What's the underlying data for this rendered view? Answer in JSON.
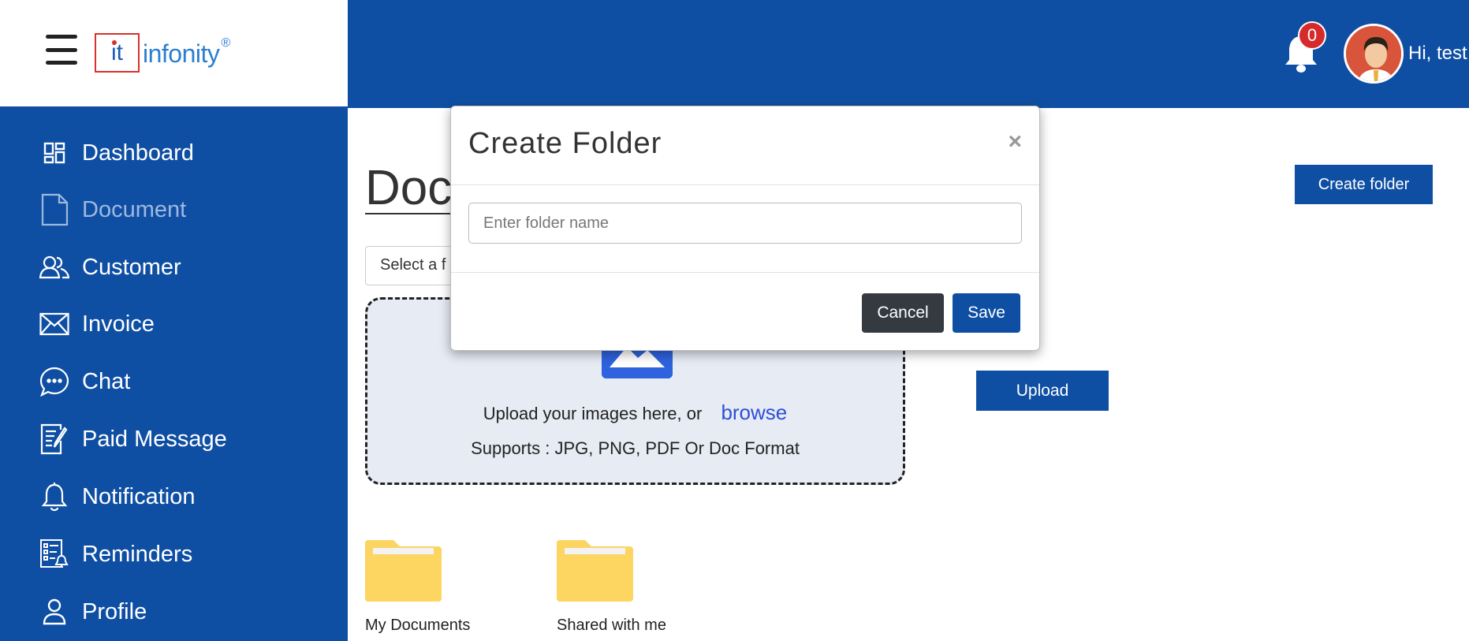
{
  "brand": {
    "logo_mark": "it",
    "logo_text": "infonity",
    "registered": "®"
  },
  "header": {
    "notification_count": "0",
    "greeting": "Hi, test"
  },
  "sidebar": {
    "items": [
      {
        "label": "Dashboard",
        "icon": "dashboard-icon"
      },
      {
        "label": "Document",
        "icon": "document-icon",
        "active": true
      },
      {
        "label": "Customer",
        "icon": "customer-icon"
      },
      {
        "label": "Invoice",
        "icon": "invoice-icon"
      },
      {
        "label": "Chat",
        "icon": "chat-icon"
      },
      {
        "label": "Paid Message",
        "icon": "paid-message-icon"
      },
      {
        "label": "Notification",
        "icon": "bell-icon"
      },
      {
        "label": "Reminders",
        "icon": "reminders-icon"
      },
      {
        "label": "Profile",
        "icon": "profile-icon"
      }
    ]
  },
  "main": {
    "title": "Doc",
    "folder_select": "Select a f",
    "create_folder_label": "Create folder",
    "upload_label": "Upload",
    "dropzone": {
      "text": "Upload your images here, or",
      "browse": "browse",
      "supports": "Supports : JPG, PNG, PDF Or Doc Format"
    },
    "folders": [
      {
        "label": "My Documents"
      },
      {
        "label": "Shared with me"
      }
    ]
  },
  "modal": {
    "title": "Create Folder",
    "close": "×",
    "input_placeholder": "Enter folder name",
    "cancel_label": "Cancel",
    "save_label": "Save"
  },
  "colors": {
    "primary": "#0f4fa3",
    "badge": "#d72a2a",
    "folder": "#fcd462",
    "dropzone_bg": "#e6ebf4",
    "browse": "#2e4fd6"
  }
}
